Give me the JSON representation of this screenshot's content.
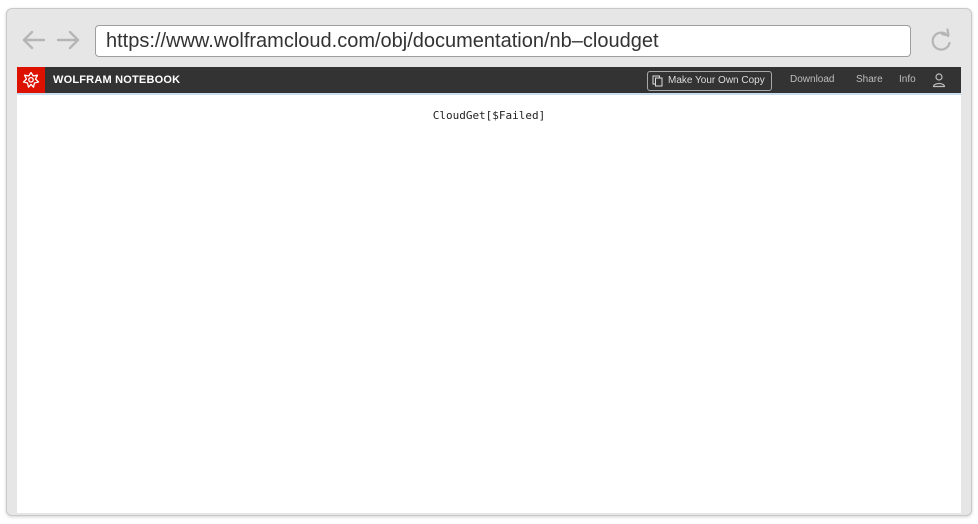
{
  "browser": {
    "url": "https://www.wolframcloud.com/obj/documentation/nb–cloudget"
  },
  "notebook": {
    "title": "WOLFRAM NOTEBOOK",
    "copy_label": "Make Your Own Copy",
    "download_label": "Download",
    "share_label": "Share",
    "info_label": "Info",
    "output_text": "CloudGet[$Failed]"
  },
  "colors": {
    "brand_red": "#dd1100",
    "header_bg": "#333333",
    "chrome_bg": "#e6e6e6"
  },
  "icons": {
    "back": "arrow-left-icon",
    "forward": "arrow-right-icon",
    "reload": "reload-icon",
    "logo": "wolfram-spikey-icon",
    "copy": "copy-icon",
    "user": "user-icon"
  }
}
